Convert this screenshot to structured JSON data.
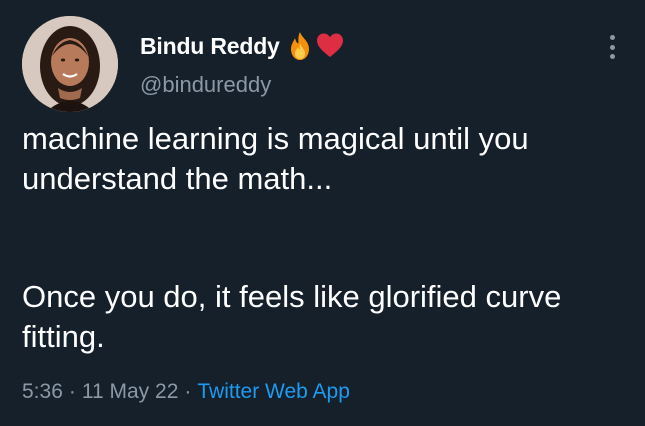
{
  "author": {
    "display_name": "Bindu Reddy",
    "handle": "@bindureddy",
    "name_emojis": [
      "fire-emoji",
      "red-heart-emoji"
    ]
  },
  "tweet": {
    "paragraph_1": "machine learning is magical until you understand the math...",
    "paragraph_2": "Once you do, it feels like glorified curve fitting."
  },
  "meta": {
    "time": "5:36",
    "separator": "·",
    "date": "11 May 22",
    "source": "Twitter Web App"
  },
  "icons": {
    "more": "more-options-icon"
  },
  "colors": {
    "background": "#15202b",
    "text_primary": "#ffffff",
    "text_secondary": "#8b98a5",
    "link": "#1d9bf0"
  }
}
